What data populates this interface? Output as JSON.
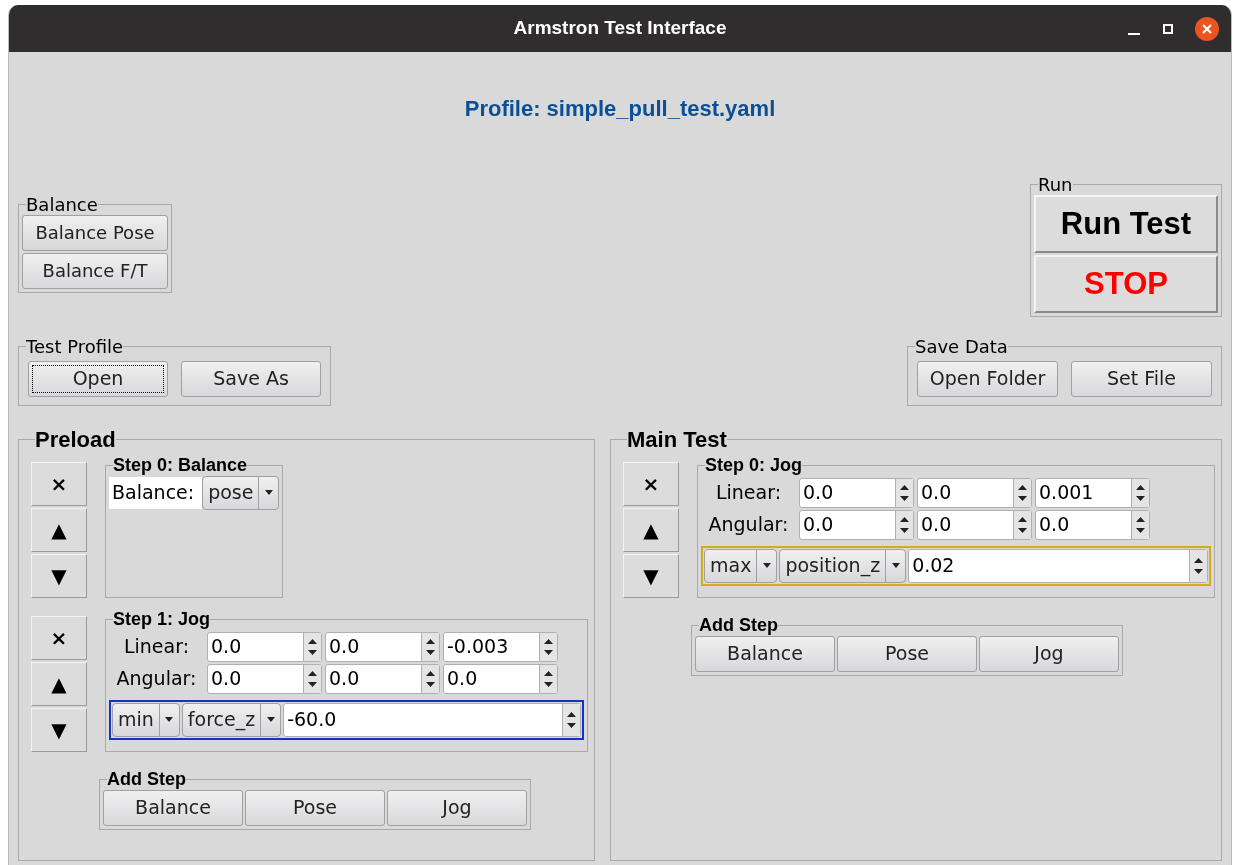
{
  "window": {
    "title": "Armstron Test Interface"
  },
  "profile_label": "Profile: simple_pull_test.yaml",
  "balance_group": {
    "title": "Balance",
    "buttons": [
      "Balance Pose",
      "Balance F/T"
    ]
  },
  "run_group": {
    "title": "Run",
    "buttons": [
      {
        "label": "Run Test",
        "kind": "run"
      },
      {
        "label": "STOP",
        "kind": "stop"
      }
    ]
  },
  "test_profile": {
    "title": "Test Profile",
    "buttons": [
      {
        "label": "Open",
        "focused": true
      },
      {
        "label": "Save As",
        "focused": false
      }
    ]
  },
  "save_data": {
    "title": "Save Data",
    "buttons": [
      "Open Folder",
      "Set File"
    ]
  },
  "sections": [
    {
      "title": "Preload",
      "steps": [
        {
          "kind": "balance",
          "title": "Step 0: Balance",
          "controls": [
            "×",
            "▲",
            "▼"
          ],
          "label": "Balance:",
          "value": "pose"
        },
        {
          "kind": "jog",
          "title": "Step 1: Jog",
          "controls": [
            "×",
            "▲",
            "▼"
          ],
          "rows": [
            {
              "label": "Linear:",
              "values": [
                "0.0",
                "0.0",
                "-0.003"
              ]
            },
            {
              "label": "Angular:",
              "values": [
                "0.0",
                "0.0",
                "0.0"
              ]
            }
          ],
          "condition": {
            "color": "#1433c8",
            "op": "min",
            "field": "force_z",
            "value": "-60.0"
          }
        }
      ],
      "add_step": {
        "title": "Add Step",
        "buttons": [
          "Balance",
          "Pose",
          "Jog"
        ]
      }
    },
    {
      "title": "Main Test",
      "steps": [
        {
          "kind": "jog",
          "title": "Step 0: Jog",
          "controls": [
            "×",
            "▲",
            "▼"
          ],
          "rows": [
            {
              "label": "Linear:",
              "values": [
                "0.0",
                "0.0",
                "0.001"
              ]
            },
            {
              "label": "Angular:",
              "values": [
                "0.0",
                "0.0",
                "0.0"
              ]
            }
          ],
          "condition": {
            "color": "#d4ac16",
            "op": "max",
            "field": "position_z",
            "value": "0.02"
          }
        }
      ],
      "add_step": {
        "title": "Add Step",
        "buttons": [
          "Balance",
          "Pose",
          "Jog"
        ]
      }
    }
  ]
}
